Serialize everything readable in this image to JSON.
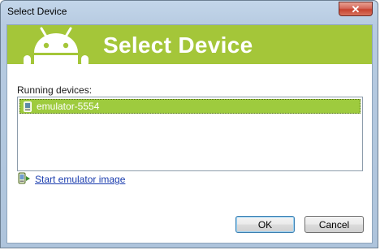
{
  "window": {
    "title": "Select Device",
    "close_glyph": "✕"
  },
  "banner": {
    "title": "Select Device",
    "logo_icon": "android-robot-icon",
    "background_color": "#a4c639"
  },
  "devices": {
    "label": "Running devices:",
    "items": [
      {
        "name": "emulator-5554",
        "icon": "phone-icon",
        "selected": true
      }
    ],
    "selection_color": "#9ecb3e"
  },
  "start_emulator": {
    "label": "Start emulator image",
    "icon": "emulator-icon"
  },
  "buttons": {
    "ok_label": "OK",
    "cancel_label": "Cancel"
  }
}
